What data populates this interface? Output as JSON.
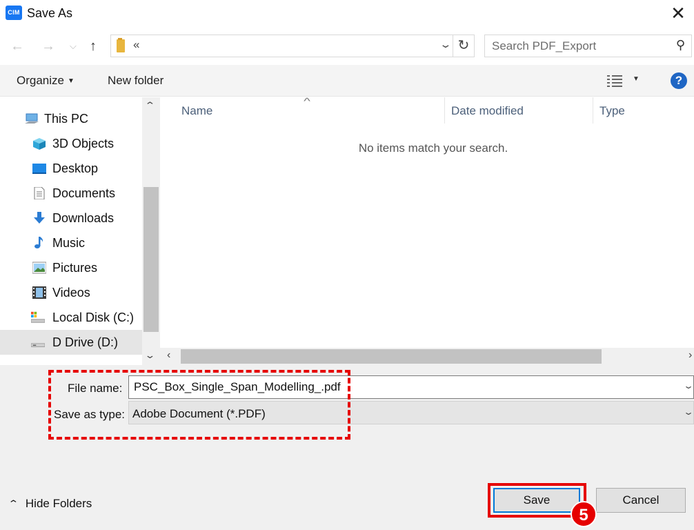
{
  "window": {
    "title": "Save As",
    "app_icon_text": "CIM",
    "close": "✕"
  },
  "nav": {
    "back": "←",
    "forward": "→",
    "recent": "⌵",
    "up": "↑",
    "address": "«",
    "refresh": "↻",
    "search_placeholder": "Search PDF_Export"
  },
  "toolbar": {
    "organize": "Organize",
    "new_folder": "New folder",
    "help": "?"
  },
  "sidebar": {
    "items": [
      {
        "label": "This PC",
        "icon": "computer-icon"
      },
      {
        "label": "3D Objects",
        "icon": "cube-icon"
      },
      {
        "label": "Desktop",
        "icon": "desktop-icon"
      },
      {
        "label": "Documents",
        "icon": "document-icon"
      },
      {
        "label": "Downloads",
        "icon": "download-icon"
      },
      {
        "label": "Music",
        "icon": "music-icon"
      },
      {
        "label": "Pictures",
        "icon": "picture-icon"
      },
      {
        "label": "Videos",
        "icon": "video-icon"
      },
      {
        "label": "Local Disk (C:)",
        "icon": "drive-c-icon"
      },
      {
        "label": "D Drive (D:)",
        "icon": "drive-d-icon",
        "selected": true
      }
    ]
  },
  "filelist": {
    "columns": [
      "Name",
      "Date modified",
      "Type"
    ],
    "empty_message": "No items match your search."
  },
  "form": {
    "file_name_label": "File name:",
    "file_name_value": "PSC_Box_Single_Span_Modelling_.pdf",
    "save_type_label": "Save as type:",
    "save_type_value": "Adobe Document (*.PDF)"
  },
  "footer": {
    "hide_folders": "Hide Folders",
    "save": "Save",
    "cancel": "Cancel",
    "step_number": "5"
  },
  "colors": {
    "annotation_red": "#e60000",
    "accent_blue": "#0078d7",
    "help_blue": "#1f66c4"
  }
}
